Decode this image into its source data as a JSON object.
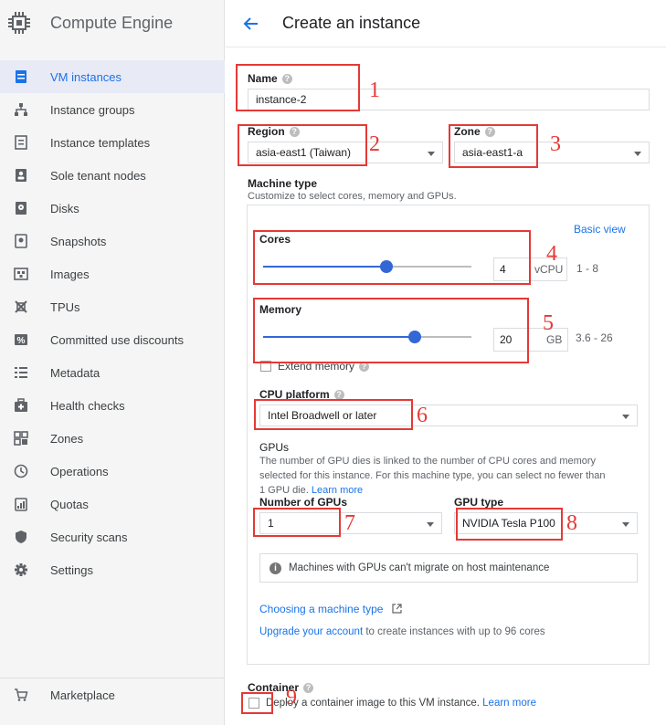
{
  "sidebar": {
    "brand": "Compute Engine",
    "items": [
      {
        "label": "VM instances",
        "icon": "vm-instances-icon"
      },
      {
        "label": "Instance groups",
        "icon": "instance-groups-icon"
      },
      {
        "label": "Instance templates",
        "icon": "instance-templates-icon"
      },
      {
        "label": "Sole tenant nodes",
        "icon": "sole-tenant-icon"
      },
      {
        "label": "Disks",
        "icon": "disk-icon"
      },
      {
        "label": "Snapshots",
        "icon": "snapshot-icon"
      },
      {
        "label": "Images",
        "icon": "images-icon"
      },
      {
        "label": "TPUs",
        "icon": "tpu-icon"
      },
      {
        "label": "Committed use discounts",
        "icon": "percent-icon"
      },
      {
        "label": "Metadata",
        "icon": "metadata-icon"
      },
      {
        "label": "Health checks",
        "icon": "health-check-icon"
      },
      {
        "label": "Zones",
        "icon": "zones-icon"
      },
      {
        "label": "Operations",
        "icon": "clock-icon"
      },
      {
        "label": "Quotas",
        "icon": "quotas-icon"
      },
      {
        "label": "Security scans",
        "icon": "shield-icon"
      },
      {
        "label": "Settings",
        "icon": "gear-icon"
      }
    ],
    "marketplace": "Marketplace"
  },
  "header": {
    "title": "Create an instance"
  },
  "form": {
    "name_label": "Name",
    "name_value": "instance-2",
    "region_label": "Region",
    "region_value": "asia-east1 (Taiwan)",
    "zone_label": "Zone",
    "zone_value": "asia-east1-a",
    "machine_type_label": "Machine type",
    "machine_type_desc": "Customize to select cores, memory and GPUs.",
    "basic_view": "Basic view",
    "cores_label": "Cores",
    "cores_value": "4",
    "cores_unit": "vCPU",
    "cores_range": "1 - 8",
    "cores_level": 0.59,
    "memory_label": "Memory",
    "memory_value": "20",
    "memory_unit": "GB",
    "memory_range": "3.6 - 26",
    "memory_level": 0.73,
    "extend_memory": "Extend memory",
    "cpu_platform_label": "CPU platform",
    "cpu_platform_value": "Intel Broadwell or later",
    "gpus_label": "GPUs",
    "gpus_desc_1": "The number of GPU dies is linked to the number of CPU cores and memory",
    "gpus_desc_2": "selected for this instance. For this machine type, you can select no fewer than",
    "gpus_desc_3": "1 GPU die.",
    "learn_more": "Learn more",
    "num_gpus_label": "Number of GPUs",
    "num_gpus_value": "1",
    "gpu_type_label": "GPU type",
    "gpu_type_value": "NVIDIA Tesla P100",
    "gpu_info": "Machines with GPUs can't migrate on host maintenance",
    "choosing_machine_type": "Choosing a machine type",
    "upgrade_account": "Upgrade your account",
    "upgrade_rest": " to create instances with up to 96 cores",
    "container_label": "Container",
    "container_desc": "Deploy a container image to this VM instance.",
    "container_learn_more": "Learn more"
  },
  "annotations": [
    "1",
    "2",
    "3",
    "4",
    "5",
    "6",
    "7",
    "8",
    "9"
  ],
  "colors": {
    "accent": "#3367d6",
    "link": "#1a73e8",
    "annotation": "#e53935",
    "sidebar_bg": "#f5f5f5",
    "active_bg": "#e8eaf6"
  }
}
